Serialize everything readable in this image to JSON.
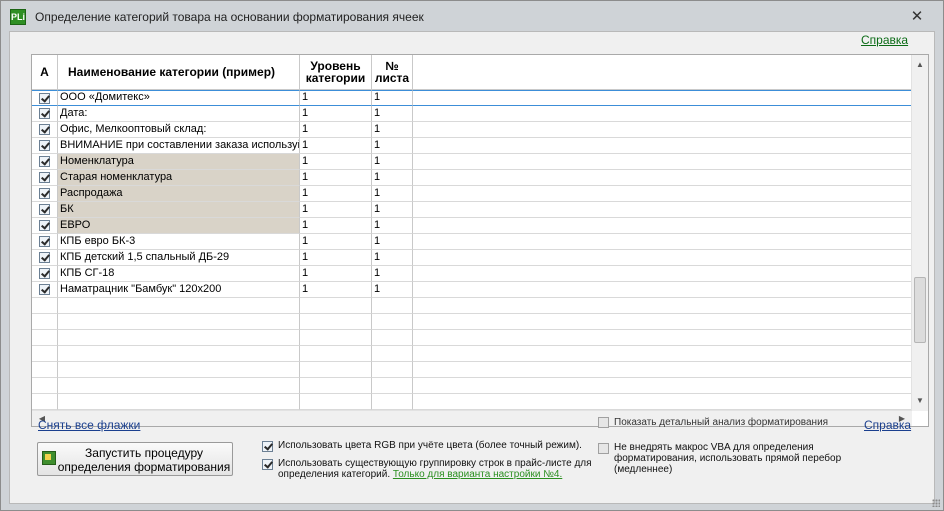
{
  "window": {
    "title": "Определение категорий товара на основании форматирования ячеек",
    "app_icon_text": "PLi",
    "close_glyph": "✕"
  },
  "help_link_top": "Справка",
  "grid": {
    "headers": {
      "check": "A",
      "name": "Наименование категории (пример)",
      "level": "Уровень категории",
      "sheet": "№ листа"
    },
    "rows": [
      {
        "checked": true,
        "name": "ООО «Домитекс»",
        "level": "1",
        "sheet": "1",
        "shaded": false,
        "selected": true
      },
      {
        "checked": true,
        "name": "Дата:",
        "level": "1",
        "sheet": "1",
        "shaded": false,
        "selected": false
      },
      {
        "checked": true,
        "name": "Офис, Мелкооптовый склад:",
        "level": "1",
        "sheet": "1",
        "shaded": false,
        "selected": false
      },
      {
        "checked": true,
        "name": "ВНИМАНИЕ при составлении заказа используйт",
        "level": "1",
        "sheet": "1",
        "shaded": false,
        "selected": false
      },
      {
        "checked": true,
        "name": "Номенклатура",
        "level": "1",
        "sheet": "1",
        "shaded": true,
        "selected": false
      },
      {
        "checked": true,
        "name": "  Старая номенклатура",
        "level": "1",
        "sheet": "1",
        "shaded": true,
        "selected": false
      },
      {
        "checked": true,
        "name": " Распродажа",
        "level": "1",
        "sheet": "1",
        "shaded": true,
        "selected": false
      },
      {
        "checked": true,
        "name": "БК",
        "level": "1",
        "sheet": "1",
        "shaded": true,
        "selected": false
      },
      {
        "checked": true,
        "name": "ЕВРО",
        "level": "1",
        "sheet": "1",
        "shaded": true,
        "selected": false
      },
      {
        "checked": true,
        "name": "КПБ евро БК-3",
        "level": "1",
        "sheet": "1",
        "shaded": false,
        "selected": false
      },
      {
        "checked": true,
        "name": "КПБ детский 1,5 спальный ДБ-29",
        "level": "1",
        "sheet": "1",
        "shaded": false,
        "selected": false
      },
      {
        "checked": true,
        "name": "КПБ СГ-18",
        "level": "1",
        "sheet": "1",
        "shaded": false,
        "selected": false
      },
      {
        "checked": true,
        "name": "Наматрацник \"Бамбук\" 120х200",
        "level": "1",
        "sheet": "1",
        "shaded": false,
        "selected": false
      }
    ],
    "empty_rows": 7
  },
  "bottom": {
    "uncheck_all": "Снять все флажки",
    "show_analysis": {
      "label": "Показать детальный анализ форматирования",
      "checked": false
    },
    "help_link": "Справка",
    "run_button": "Запустить процедуру определения форматирования",
    "use_rgb": {
      "label": "Использовать цвета RGB при учёте цвета (более точный режим).",
      "checked": true
    },
    "use_grouping": {
      "label": "Использовать существующую группировку строк в прайс-листе для определения категорий.",
      "checked": true
    },
    "variant_link": "Только для варианта настройки №4.",
    "no_vba": {
      "label": "Не внедрять макрос VBA для определения форматирования, использовать прямой перебор (медленнее)",
      "checked": false
    }
  },
  "colors": {
    "shaded_row": "#d9d3c8",
    "selection_border": "#3c8ed8",
    "link_green": "#0b6b16",
    "link_blue": "#1a3f8e"
  }
}
